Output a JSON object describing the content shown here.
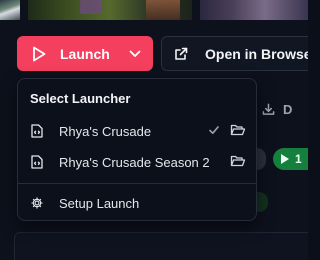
{
  "launch_button": {
    "label": "Launch"
  },
  "browser_button": {
    "label": "Open in Browser"
  },
  "background": {
    "download_label": "D",
    "badge_text": "1"
  },
  "launcher_menu": {
    "header": "Select Launcher",
    "items": [
      {
        "label": "Rhya's Crusade",
        "selected": true
      },
      {
        "label": "Rhya's Crusade Season 2",
        "selected": false
      }
    ],
    "setup_label": "Setup Launch"
  },
  "colors": {
    "accent": "#f43f5e",
    "badge_green": "#15803d",
    "menu_bg": "#0c101b"
  }
}
